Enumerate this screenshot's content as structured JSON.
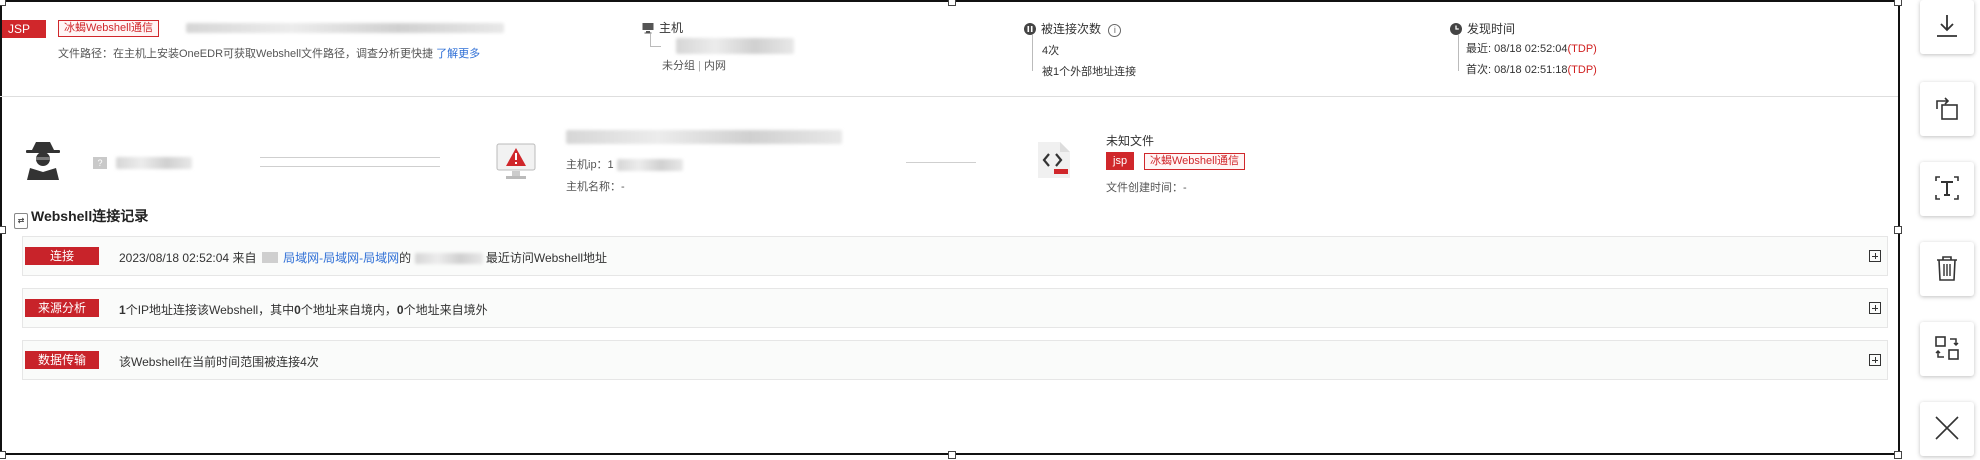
{
  "summary": {
    "type_badge": "JSP",
    "title_tag": "冰蝎Webshell通信",
    "file_path_text": "文件路径：在主机上安装OneEDR可获取Webshell文件路径，调查分析更快捷",
    "learn_more": "了解更多",
    "host_label": "主机",
    "host_group": "未分组",
    "host_sep": "|",
    "host_extra": "内网",
    "connections_label": "被连接次数",
    "connections_count": "4次",
    "connections_detail": "被1个外部地址连接",
    "discovery_label": "发现时间",
    "latest_label": "最近: 08/18 02:52:04",
    "latest_src": "(TDP)",
    "first_label": "首次: 08/18 02:51:18",
    "first_src": "(TDP)"
  },
  "flow": {
    "attacker_tag": "?",
    "host_ip_label": "主机ip：1",
    "host_name_label": "主机名称：-",
    "file_title": "未知文件",
    "file_badge": "jsp",
    "file_tag": "冰蝎Webshell通信",
    "file_created": "文件创建时间：-"
  },
  "records": {
    "title": "Webshell连接记录",
    "items": [
      {
        "badge": "连接",
        "prefix": "2023/08/18 02:52:04  来自",
        "link": "局域网-局域网-局域网",
        "mid": "的",
        "suffix": "最近访问Webshell地址"
      },
      {
        "badge": "来源分析",
        "n1": "1",
        "t1": "个IP地址连接该Webshell，其中",
        "n2": "0",
        "t2": "个地址来自境内，",
        "n3": "0",
        "t3": "个地址来自境外"
      },
      {
        "badge": "数据传输",
        "text": "该Webshell在当前时间范围被连接4次"
      }
    ]
  },
  "toolbar": {
    "tools": [
      "download-icon",
      "rotate-icon",
      "text-icon",
      "trash-icon",
      "swap-icon",
      "close-icon"
    ]
  },
  "colors": {
    "badge_red": "#d0272b",
    "link_blue": "#2f6fd6"
  }
}
